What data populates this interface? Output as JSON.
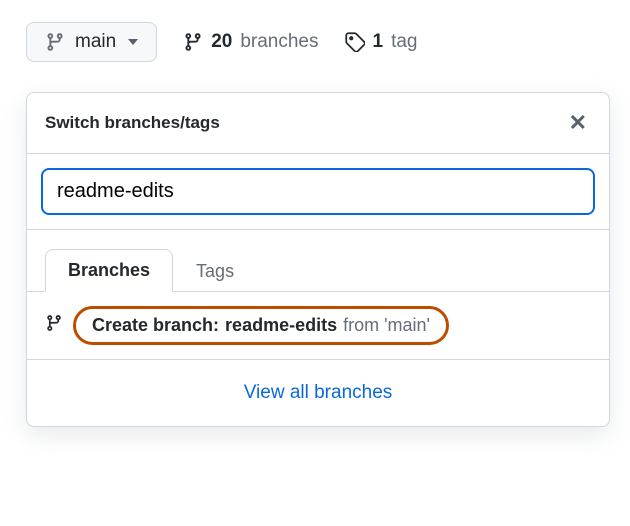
{
  "topbar": {
    "current_branch": "main",
    "branches_count": "20",
    "branches_label": "branches",
    "tags_count": "1",
    "tags_label": "tag"
  },
  "popover": {
    "title": "Switch branches/tags",
    "filter_value": "readme-edits",
    "tabs": {
      "branches": "Branches",
      "tags": "Tags"
    },
    "create": {
      "prefix": "Create branch: ",
      "name": "readme-edits",
      "from": " from 'main'"
    },
    "view_all": "View all branches"
  }
}
